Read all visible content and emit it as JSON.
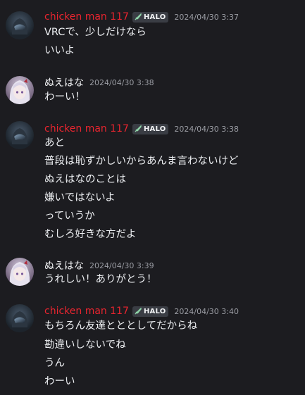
{
  "messages": [
    {
      "author": "chicken man 117",
      "author_color": "#e8252f",
      "tag": "HALO",
      "tag_icon": "sword-icon",
      "timestamp": "2024/04/30 3:37",
      "avatar": "helmet-avatar",
      "lines": [
        "VRCで、少しだけなら",
        "いいよ"
      ]
    },
    {
      "author": "ぬえはな",
      "author_color": "#f2f3f5",
      "timestamp": "2024/04/30 3:38",
      "avatar": "anime-girl-avatar",
      "lines": [
        "わーい！"
      ]
    },
    {
      "author": "chicken man 117",
      "author_color": "#e8252f",
      "tag": "HALO",
      "tag_icon": "sword-icon",
      "timestamp": "2024/04/30 3:38",
      "avatar": "helmet-avatar",
      "lines": [
        "あと",
        "普段は恥ずかしいからあんま言わないけど",
        "ぬえはなのことは",
        "嫌いではないよ",
        "っていうか",
        "むしろ好きな方だよ"
      ]
    },
    {
      "author": "ぬえはな",
      "author_color": "#f2f3f5",
      "timestamp": "2024/04/30 3:39",
      "avatar": "anime-girl-avatar",
      "lines": [
        "うれしい！ありがとう！"
      ]
    },
    {
      "author": "chicken man 117",
      "author_color": "#e8252f",
      "tag": "HALO",
      "tag_icon": "sword-icon",
      "timestamp": "2024/04/30 3:40",
      "avatar": "helmet-avatar",
      "lines": [
        "もちろん友達とととしてだからね",
        "勘違いしないでね",
        "うん",
        "わーい"
      ]
    }
  ]
}
